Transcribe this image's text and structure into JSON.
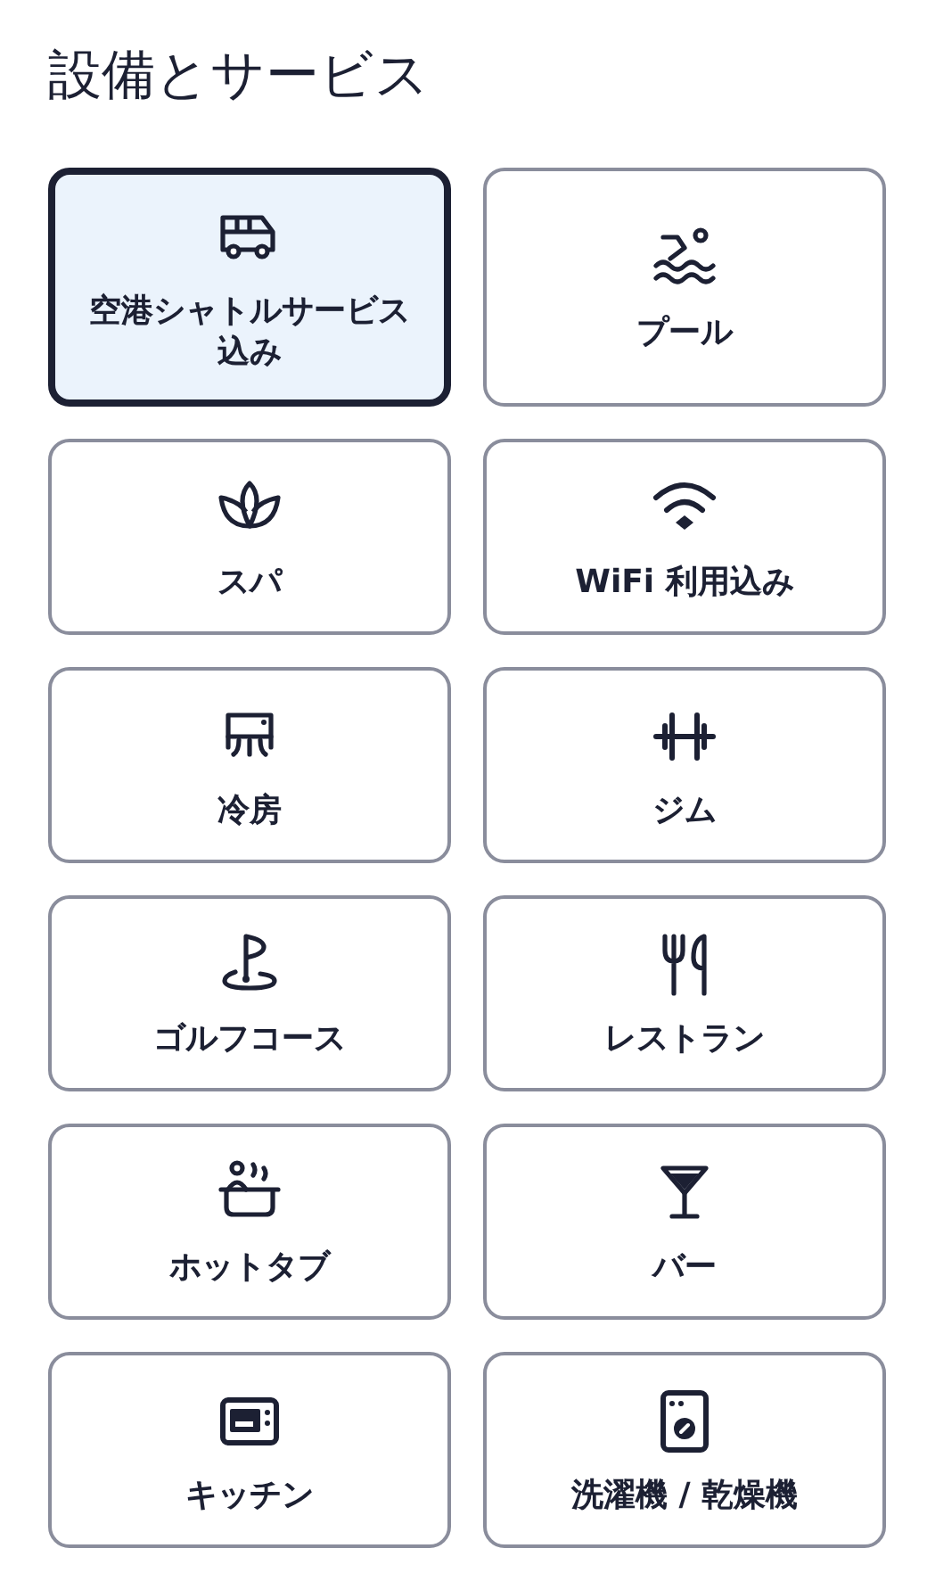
{
  "title": "設備とサービス",
  "amenities": [
    {
      "label": "空港シャトルサービス込み",
      "selected": true
    },
    {
      "label": "プール",
      "selected": false
    },
    {
      "label": "スパ",
      "selected": false
    },
    {
      "label": "WiFi 利用込み",
      "selected": false
    },
    {
      "label": "冷房",
      "selected": false
    },
    {
      "label": "ジム",
      "selected": false
    },
    {
      "label": "ゴルフコース",
      "selected": false
    },
    {
      "label": "レストラン",
      "selected": false
    },
    {
      "label": "ホットタブ",
      "selected": false
    },
    {
      "label": "バー",
      "selected": false
    },
    {
      "label": "キッチン",
      "selected": false
    },
    {
      "label": "洗濯機 / 乾燥機",
      "selected": false
    }
  ]
}
